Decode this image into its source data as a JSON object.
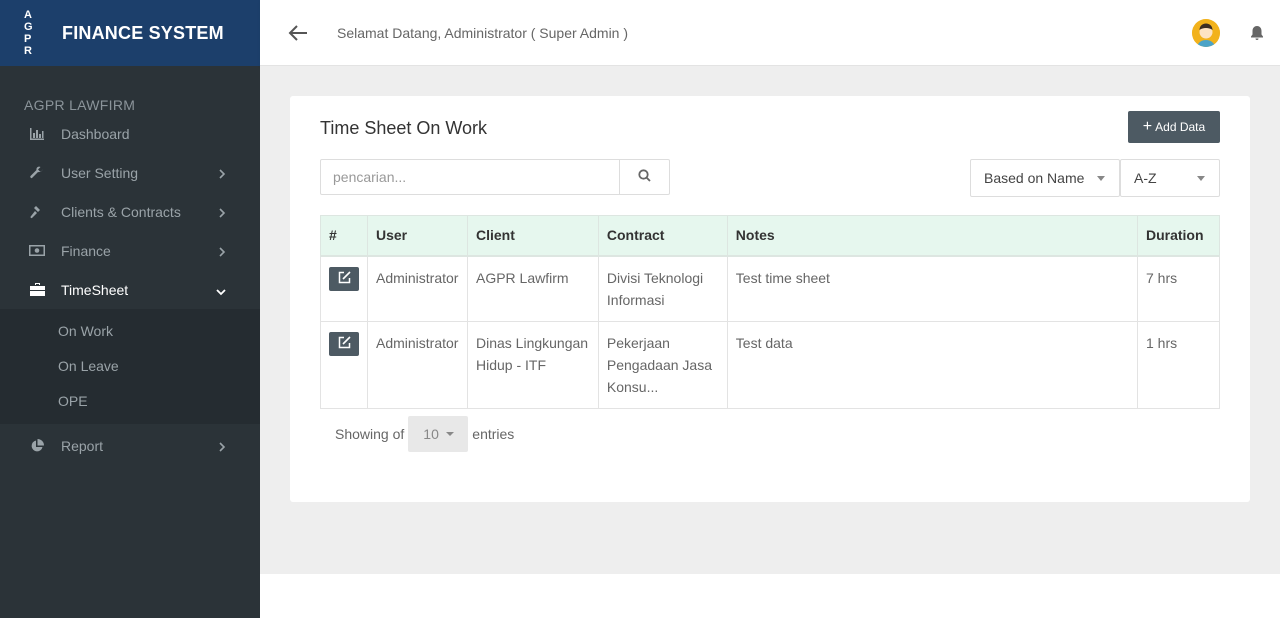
{
  "brand": {
    "logo_text": "A G P R",
    "title": "FINANCE SYSTEM"
  },
  "sidebar": {
    "org_name": "AGPR LAWFIRM",
    "items": [
      {
        "label": "Dashboard",
        "icon": "bar-chart-icon"
      },
      {
        "label": "User Setting",
        "icon": "wrench-icon"
      },
      {
        "label": "Clients & Contracts",
        "icon": "gavel-icon"
      },
      {
        "label": "Finance",
        "icon": "money-icon"
      },
      {
        "label": "TimeSheet",
        "icon": "briefcase-icon"
      },
      {
        "label": "Report",
        "icon": "pie-chart-icon"
      }
    ],
    "timesheet_submenu": [
      "On Work",
      "On Leave",
      "OPE"
    ]
  },
  "topbar": {
    "welcome": "Selamat Datang, Administrator ( Super Admin )"
  },
  "main": {
    "title": "Time Sheet On Work",
    "add_label": "Add Data",
    "search_placeholder": "pencarian...",
    "sort_field": "Based on Name",
    "sort_order": "A-Z",
    "table": {
      "headers": [
        "#",
        "User",
        "Client",
        "Contract",
        "Notes",
        "Duration"
      ],
      "rows": [
        {
          "user": "Administrator",
          "client": "AGPR Lawfirm",
          "contract": "Divisi Teknologi Informasi",
          "notes": "Test time sheet",
          "duration": "7 hrs"
        },
        {
          "user": "Administrator",
          "client": "Dinas Lingkungan Hidup - ITF",
          "contract": "Pekerjaan Pengadaan Jasa Konsu...",
          "notes": "Test data",
          "duration": "1 hrs"
        }
      ]
    },
    "showing_prefix": "Showing of",
    "page_size": "10",
    "showing_suffix": "entries"
  },
  "colors": {
    "sidebar_bg": "#2b3338",
    "brand_bg": "#1c3f6b",
    "table_header_bg": "#e6f7ee",
    "button_bg": "#4d5a63"
  }
}
